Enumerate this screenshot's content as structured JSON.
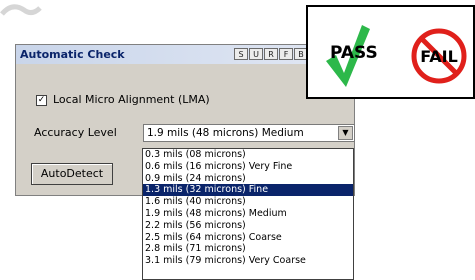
{
  "dialog": {
    "title": "Automatic Check",
    "title_buttons": [
      "S",
      "U",
      "R",
      "F",
      "B"
    ],
    "lma_checked": true,
    "lma_label": "Local Micro Alignment (LMA)",
    "accuracy_label": "Accuracy Level",
    "accuracy_value": "1.9 mils (48 microns) Medium",
    "autodetect_label": "AutoDetect"
  },
  "dropdown": {
    "options": [
      "0.3 mils (08 microns)",
      "0.6 mils (16 microns) Very Fine",
      "0.9 mils (24 microns)",
      "1.3 mils (32 microns) Fine",
      "1.6 mils (40 microns)",
      "1.9 mils (48 microns) Medium",
      "2.2 mils (56 microns)",
      "2.5 mils (64 microns) Coarse",
      "2.8 mils (71 microns)",
      "3.1 mils (79 microns) Very Coarse"
    ],
    "selected_index": 3
  },
  "pass_fail": {
    "pass_label": "PASS",
    "fail_label": "FAIL",
    "pass_color": "#2db84a",
    "fail_color": "#e0201b"
  },
  "colors": {
    "dialog_bg": "#d4d0c8",
    "selection": "#0a246a"
  }
}
